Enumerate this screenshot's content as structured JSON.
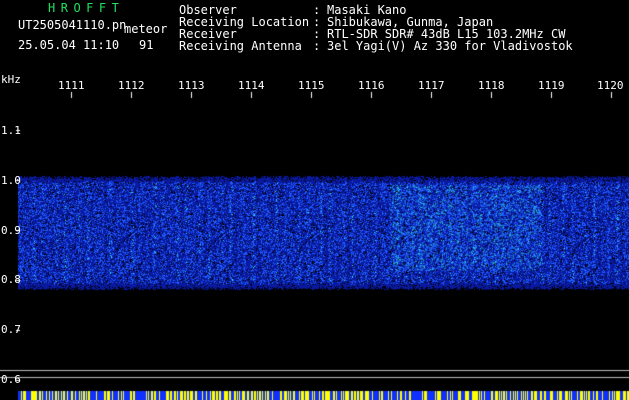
{
  "header": {
    "app_title": "HROFFT",
    "file_name": "UT2505041110.pn",
    "file_tag": "meteor",
    "date_time": "25.05.04 11:10",
    "count": "91"
  },
  "station_info": [
    {
      "label": "Observer",
      "value": "Masaki Kano"
    },
    {
      "label": "Receiving Location",
      "value": "Shibukawa, Gunma, Japan"
    },
    {
      "label": "Receiver",
      "value": "RTL-SDR SDR# 43dB L15 103.2MHz CW"
    },
    {
      "label": "Receiving Antenna",
      "value": "3el Yagi(V) Az 330 for Vladivostok"
    }
  ],
  "separator": ":",
  "axis": {
    "unit": "kHz",
    "y_ticks": [
      {
        "label": "1.1",
        "value": 1.1
      },
      {
        "label": "1.0",
        "value": 1.0
      },
      {
        "label": "0.9",
        "value": 0.9
      },
      {
        "label": "0.8",
        "value": 0.8
      },
      {
        "label": "0.7",
        "value": 0.7
      },
      {
        "label": "0.6",
        "value": 0.6
      }
    ],
    "x_ticks": [
      "1111",
      "1112",
      "1113",
      "1114",
      "1115",
      "1116",
      "1117",
      "1118",
      "1119",
      "1120"
    ],
    "x_ticks_last_full": "1120"
  },
  "spectrogram": {
    "band_low_khz": 0.78,
    "band_high_khz": 1.01,
    "colors": {
      "background": "#000000",
      "noise_dark": "#0a1aa0",
      "noise_mid": "#1f5cff",
      "noise_bright": "#2fd8e8",
      "grid": "#bbbbbb",
      "bottom_bar_blue": "#1030ff",
      "bottom_bar_yellow": "#ffff00",
      "title_green": "#22e05a"
    }
  }
}
